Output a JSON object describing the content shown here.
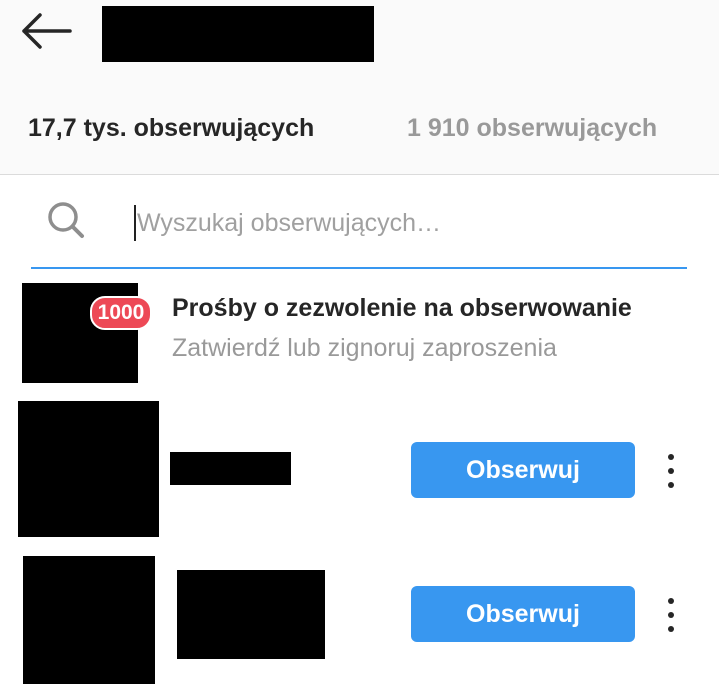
{
  "header": {
    "back_icon": "back-arrow-icon",
    "title_redacted": true
  },
  "tabs": [
    {
      "label": "17,7 tys. obserwujących",
      "active": true
    },
    {
      "label": "1 910 obserwujących",
      "active": false
    }
  ],
  "search": {
    "icon": "search-icon",
    "placeholder": "Wyszukaj obserwujących…",
    "value": ""
  },
  "follow_requests": {
    "badge": "1000",
    "title": "Prośby o zezwolenie na obserwowanie",
    "subtitle": "Zatwierdź lub zignoruj zaproszenia"
  },
  "users": [
    {
      "button_label": "Obserwuj",
      "more_icon": "more-vertical-icon"
    },
    {
      "button_label": "Obserwuj",
      "more_icon": "more-vertical-icon"
    }
  ],
  "colors": {
    "accent": "#3897f0",
    "badge": "#ed4956",
    "text_primary": "#262626",
    "text_secondary": "#999999",
    "header_bg": "#fafafa"
  }
}
